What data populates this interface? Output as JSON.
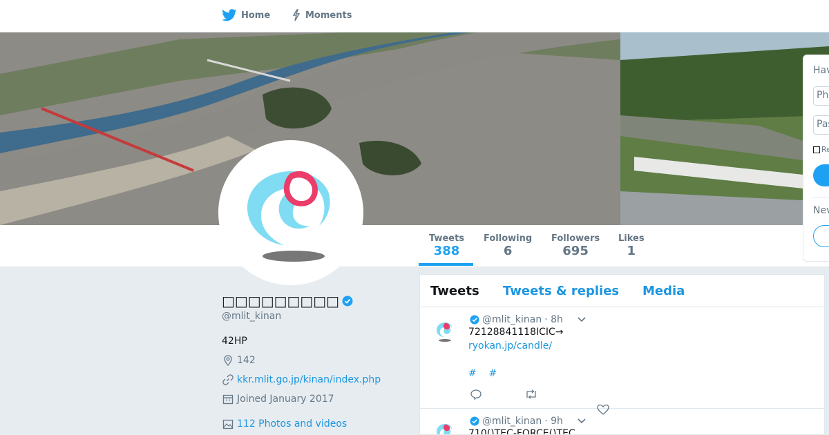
{
  "nav": {
    "home_label": "Home",
    "moments_label": "Moments"
  },
  "login": {
    "have_account": "Hav",
    "phone_placeholder": "Ph",
    "password_placeholder": "Pas",
    "remember": "Re",
    "new_to": "Nev"
  },
  "stats": [
    {
      "label": "Tweets",
      "value": "388"
    },
    {
      "label": "Following",
      "value": "6"
    },
    {
      "label": "Followers",
      "value": "695"
    },
    {
      "label": "Likes",
      "value": "1"
    }
  ],
  "profile": {
    "name": "□□□□□□□□□",
    "handle": "@mlit_kinan",
    "bio": "42HP",
    "location": "142",
    "website": "kkr.mlit.go.jp/kinan/index.php",
    "joined": "Joined January 2017",
    "photos": "112 Photos and videos"
  },
  "timeline": {
    "tabs": [
      "Tweets",
      "Tweets & replies",
      "Media"
    ],
    "tweets": [
      {
        "handle": "@mlit_kinan",
        "time": "· 8h",
        "text": "72128841118ICIC→",
        "link": "ryokan.jp/candle/",
        "hashtags": "#    #"
      },
      {
        "handle": "@mlit_kinan",
        "time": "· 9h",
        "text": "710()TEC-FORCE()TEC"
      }
    ]
  },
  "colors": {
    "accent": "#1da1f2",
    "link": "#1b95e0",
    "muted": "#657786",
    "logo_pink": "#ec3c6a",
    "logo_cyan": "#7fdcf2"
  }
}
